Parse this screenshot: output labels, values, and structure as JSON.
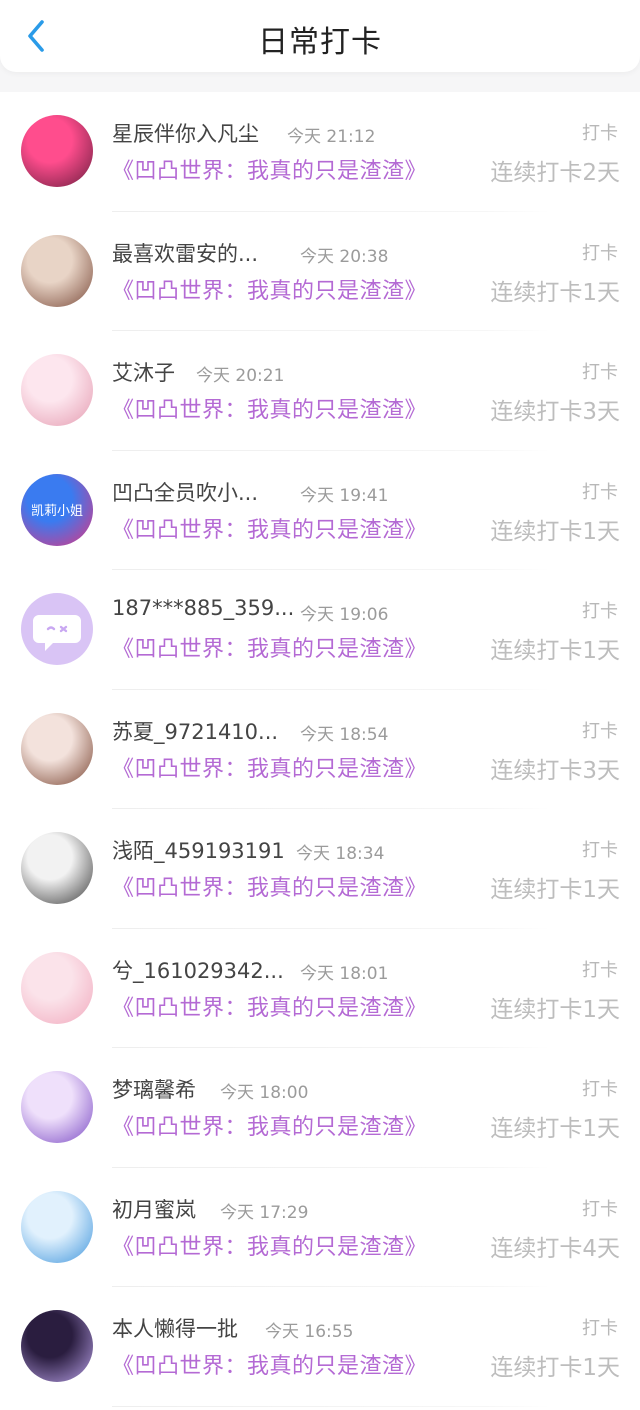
{
  "header": {
    "title": "日常打卡",
    "back_icon": "chevron-left-icon"
  },
  "colors": {
    "accent": "#2a9be8",
    "book_title": "#b46ad4",
    "muted": "#bdbdbd"
  },
  "items": [
    {
      "name": "星辰伴你入凡尘",
      "time": "今天 21:12",
      "book": "《凹凸世界：我真的只是渣渣》",
      "tag": "打卡",
      "streak": "连续打卡2天",
      "avatar_bg": [
        "#ff4d8d",
        "#6a1d3e"
      ]
    },
    {
      "name": "最喜欢雷安的...",
      "time": "今天 20:38",
      "book": "《凹凸世界：我真的只是渣渣》",
      "tag": "打卡",
      "streak": "连续打卡1天",
      "avatar_bg": [
        "#e8d4c6",
        "#7a4a3a"
      ]
    },
    {
      "name": "艾沐子",
      "time": "今天 20:21",
      "book": "《凹凸世界：我真的只是渣渣》",
      "tag": "打卡",
      "streak": "连续打卡3天",
      "avatar_bg": [
        "#fde6ee",
        "#e49bb0"
      ]
    },
    {
      "name": "凹凸全员吹小...",
      "time": "今天 19:41",
      "book": "《凹凸世界：我真的只是渣渣》",
      "tag": "打卡",
      "streak": "连续打卡1天",
      "avatar_bg": [
        "#3a7bf0",
        "#e2327e"
      ],
      "avatar_text": "凯莉小姐"
    },
    {
      "name": "187***885_359...",
      "time": "今天 19:06",
      "book": "《凹凸世界：我真的只是渣渣》",
      "tag": "打卡",
      "streak": "连续打卡1天",
      "avatar_bg": [
        "#d9c4f5",
        "#c9a8f2"
      ]
    },
    {
      "name": "苏夏_9721410...",
      "time": "今天 18:54",
      "book": "《凹凸世界：我真的只是渣渣》",
      "tag": "打卡",
      "streak": "连续打卡3天",
      "avatar_bg": [
        "#f3e2dc",
        "#7a4532"
      ]
    },
    {
      "name": "浅陌_459193191",
      "time": "今天 18:34",
      "book": "《凹凸世界：我真的只是渣渣》",
      "tag": "打卡",
      "streak": "连续打卡1天",
      "avatar_bg": [
        "#f2f2f2",
        "#3b3b3b"
      ]
    },
    {
      "name": "兮_161029342...",
      "time": "今天 18:01",
      "book": "《凹凸世界：我真的只是渣渣》",
      "tag": "打卡",
      "streak": "连续打卡1天",
      "avatar_bg": [
        "#fbe3ea",
        "#f1a9bd"
      ]
    },
    {
      "name": "梦璃馨希",
      "time": "今天 18:00",
      "book": "《凹凸世界：我真的只是渣渣》",
      "tag": "打卡",
      "streak": "连续打卡1天",
      "avatar_bg": [
        "#efe0fb",
        "#7b4bc4"
      ]
    },
    {
      "name": "初月蜜岚",
      "time": "今天 17:29",
      "book": "《凹凸世界：我真的只是渣渣》",
      "tag": "打卡",
      "streak": "连续打卡4天",
      "avatar_bg": [
        "#e1f1fd",
        "#3f95dc"
      ]
    },
    {
      "name": "本人懒得一批",
      "time": "今天 16:55",
      "book": "《凹凸世界：我真的只是渣渣》",
      "tag": "打卡",
      "streak": "连续打卡1天",
      "avatar_bg": [
        "#2a1d3f",
        "#b9a1e8"
      ]
    }
  ]
}
